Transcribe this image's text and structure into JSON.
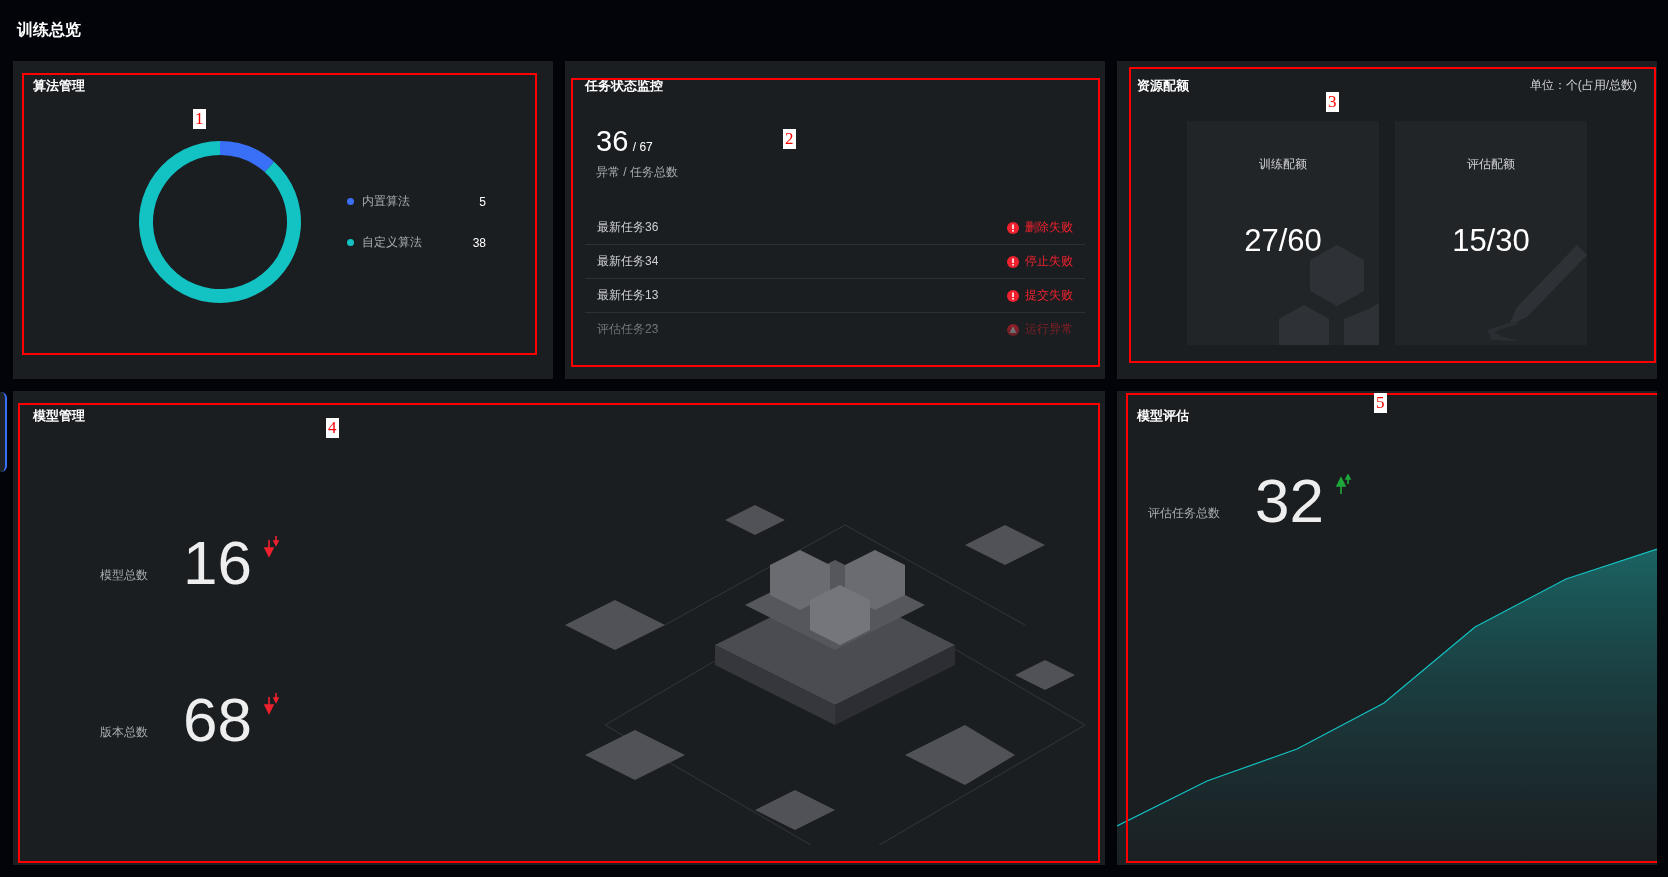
{
  "page_title": "训练总览",
  "algorithms": {
    "title": "算法管理",
    "annotation": "1",
    "chart_data": {
      "type": "donut",
      "categories": [
        "内置算法",
        "自定义算法"
      ],
      "values": [
        11.63,
        88.37
      ],
      "legend": "right"
    },
    "legend": [
      {
        "value": "5",
        "color": "#3a6ff7"
      },
      {
        "value": "38",
        "color": "#13c2c2"
      }
    ]
  },
  "tasks": {
    "title": "任务状态监控",
    "annotation": "2",
    "abnormal": "36",
    "total": "/ 67",
    "caption": "异常 / 任务总数",
    "rows": [
      {
        "name": "最新任务36",
        "status": "删除失败",
        "kind": "error"
      },
      {
        "name": "最新任务34",
        "status": "停止失败",
        "kind": "error"
      },
      {
        "name": "最新任务13",
        "status": "提交失败",
        "kind": "error"
      },
      {
        "name": "评估任务23",
        "status": "运行异常",
        "kind": "warning"
      }
    ]
  },
  "quota": {
    "title": "资源配额",
    "annotation": "3",
    "unit": "单位：个(占用/总数)",
    "items": [
      {
        "label": "训练配额",
        "value": "27/60",
        "kind": "hexagon"
      },
      {
        "label": "评估配额",
        "value": "15/30",
        "kind": "pencil"
      }
    ]
  },
  "models": {
    "title": "模型管理",
    "annotation": "4",
    "stats": [
      {
        "label": "模型总数",
        "value": "16",
        "kind": "down"
      },
      {
        "label": "版本总数",
        "value": "68",
        "kind": "down"
      }
    ]
  },
  "evaluation": {
    "title": "模型评估",
    "annotation": "5",
    "label": "评估任务总数",
    "value": "32",
    "kind": "up"
  }
}
